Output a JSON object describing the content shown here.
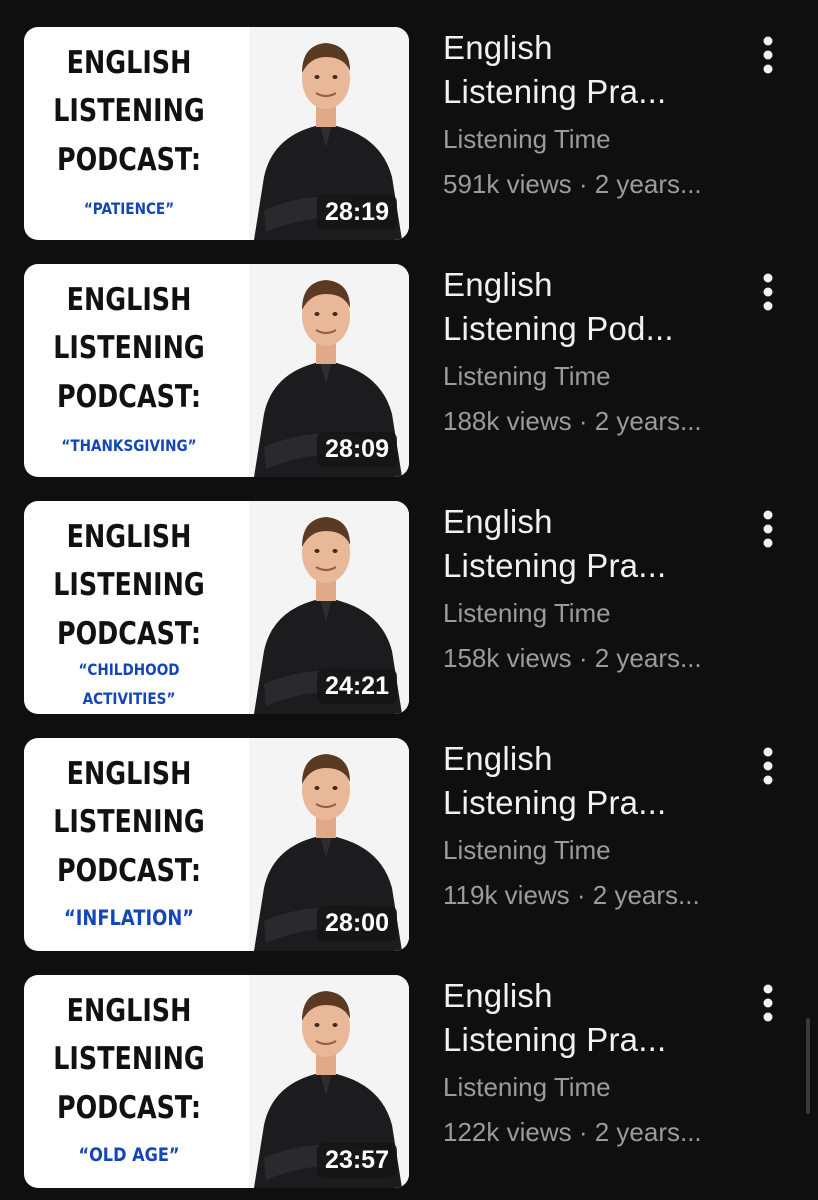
{
  "videos": [
    {
      "thumb_lines": [
        "ENGLISH",
        "LISTENING",
        "PODCAST:"
      ],
      "thumb_topic": [
        "“PATIENCE”"
      ],
      "duration": "28:19",
      "title_line1": "English",
      "title_line2": "Listening Pra...",
      "channel": "Listening Time",
      "meta": "591k views · 2 years..."
    },
    {
      "thumb_lines": [
        "ENGLISH",
        "LISTENING",
        "PODCAST:"
      ],
      "thumb_topic": [
        "“THANKSGIVING”"
      ],
      "duration": "28:09",
      "title_line1": "English",
      "title_line2": "Listening Pod...",
      "channel": "Listening Time",
      "meta": "188k views · 2 years..."
    },
    {
      "thumb_lines": [
        "ENGLISH",
        "LISTENING",
        "PODCAST:"
      ],
      "thumb_topic": [
        "“CHILDHOOD",
        "ACTIVITIES”"
      ],
      "duration": "24:21",
      "title_line1": "English",
      "title_line2": "Listening Pra...",
      "channel": "Listening Time",
      "meta": "158k views · 2 years..."
    },
    {
      "thumb_lines": [
        "ENGLISH",
        "LISTENING",
        "PODCAST:"
      ],
      "thumb_topic": [
        "“INFLATION”"
      ],
      "duration": "28:00",
      "title_line1": "English",
      "title_line2": "Listening Pra...",
      "channel": "Listening Time",
      "meta": "119k views · 2 years..."
    },
    {
      "thumb_lines": [
        "ENGLISH",
        "LISTENING",
        "PODCAST:"
      ],
      "thumb_topic": [
        "“OLD AGE”"
      ],
      "duration": "23:57",
      "title_line1": "English",
      "title_line2": "Listening Pra...",
      "channel": "Listening Time",
      "meta": "122k views · 2 years..."
    }
  ],
  "icons": {
    "more": "more-vert-icon"
  },
  "colors": {
    "background": "#0f0f0f",
    "title": "#f1f1f1",
    "secondary_text": "#9b9b9b",
    "topic_blue": "#1446b8",
    "duration_badge": "#141414"
  }
}
